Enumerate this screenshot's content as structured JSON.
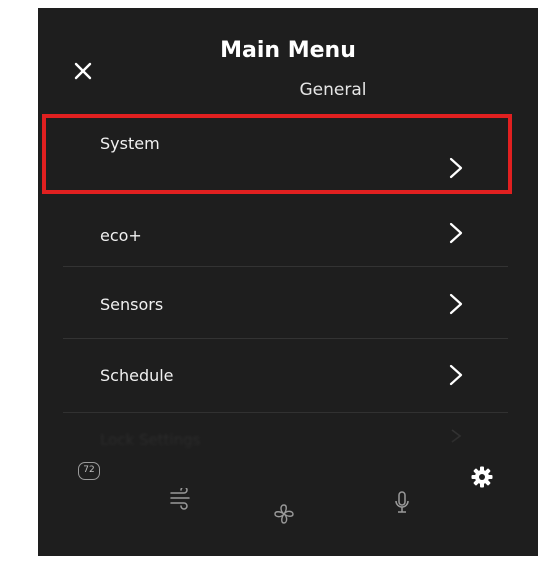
{
  "header": {
    "title": "Main Menu",
    "subtitle": "General"
  },
  "menu": {
    "items": [
      {
        "label": "System",
        "highlighted": true
      },
      {
        "label": "eco+"
      },
      {
        "label": "Sensors"
      },
      {
        "label": "Schedule"
      },
      {
        "label": "Lock Settings"
      }
    ]
  },
  "bottom_nav": {
    "temperature": "72",
    "icons": [
      "thermostat-icon",
      "air-flow-icon",
      "fan-icon",
      "microphone-icon",
      "settings-gear-icon"
    ],
    "active": "settings-gear-icon"
  },
  "colors": {
    "background": "#1e1e1e",
    "text": "#ffffff",
    "highlight_border": "#e02020",
    "icon_inactive": "#9a9a9a"
  }
}
